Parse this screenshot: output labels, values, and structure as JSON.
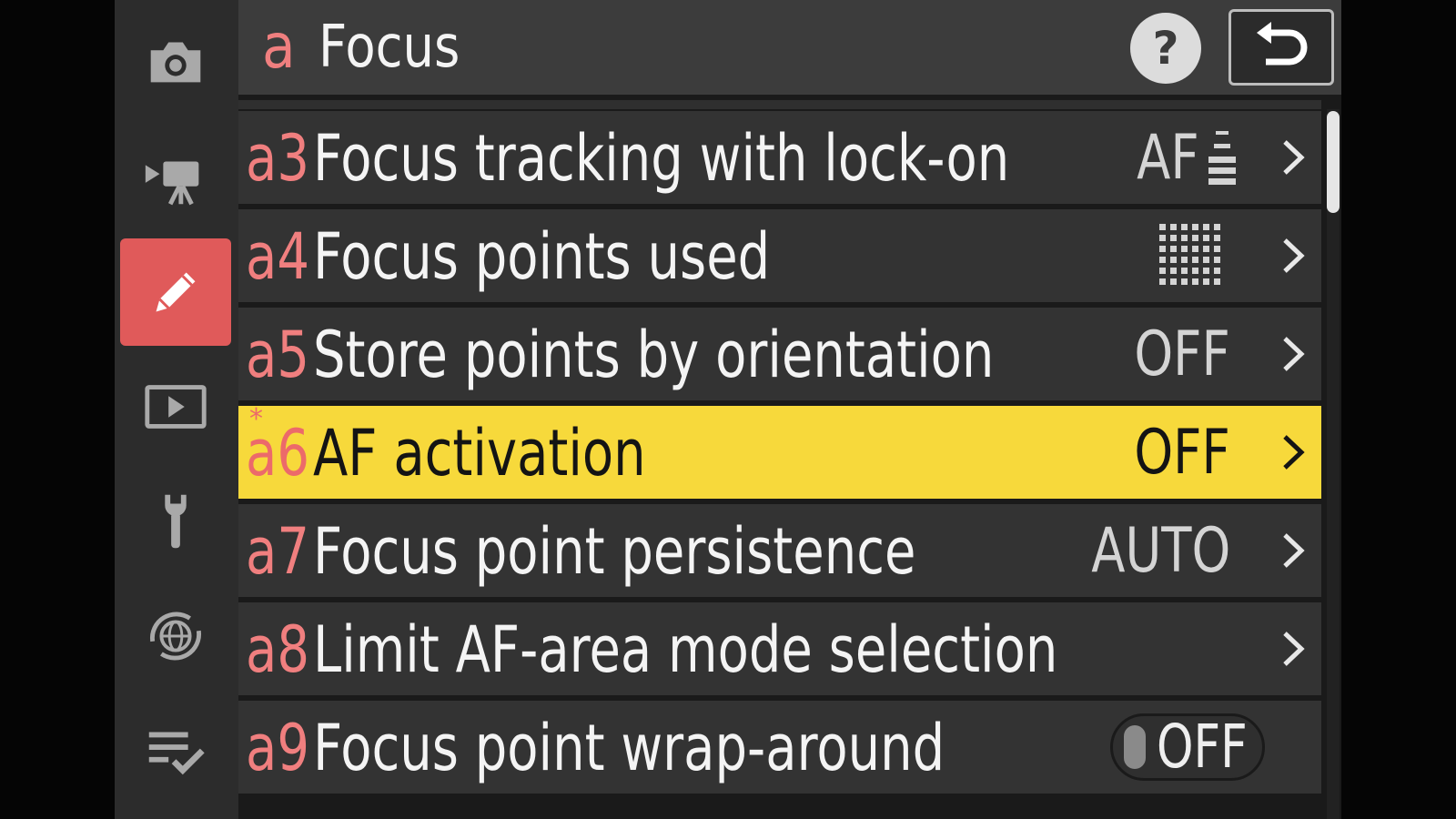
{
  "sidebar": {
    "tabs": [
      {
        "icon": "camera-icon",
        "active": false
      },
      {
        "icon": "movie-camera-icon",
        "active": false
      },
      {
        "icon": "pencil-icon",
        "active": true
      },
      {
        "icon": "playback-icon",
        "active": false
      },
      {
        "icon": "wrench-icon",
        "active": false
      },
      {
        "icon": "network-globe-icon",
        "active": false
      },
      {
        "icon": "my-menu-icon",
        "active": false
      }
    ]
  },
  "header": {
    "letter": "a",
    "title": "Focus",
    "help_label": "?"
  },
  "rows": [
    {
      "code": "a3",
      "label": "Focus tracking with lock-on",
      "value": "AF",
      "value_icon": "lock-on-level-icon"
    },
    {
      "code": "a4",
      "label": "Focus points used",
      "value": "",
      "value_icon": "focus-points-grid-icon"
    },
    {
      "code": "a5",
      "label": "Store points by orientation",
      "value": "OFF"
    },
    {
      "code": "a6",
      "label": "AF activation",
      "value": "OFF",
      "selected": true,
      "modified_mark": "*"
    },
    {
      "code": "a7",
      "label": "Focus point persistence",
      "value": "AUTO"
    },
    {
      "code": "a8",
      "label": "Limit AF-area mode selection",
      "value": ""
    },
    {
      "code": "a9",
      "label": "Focus point wrap-around",
      "value": "OFF",
      "value_style": "toggle"
    }
  ],
  "scroll": {
    "position_fraction": 0.0
  },
  "colors": {
    "accent_red": "#e05a5a",
    "code_pink": "#f07f7f",
    "highlight_yellow": "#f7d93b",
    "row_bg": "#333333",
    "header_bg": "#3c3c3c"
  }
}
